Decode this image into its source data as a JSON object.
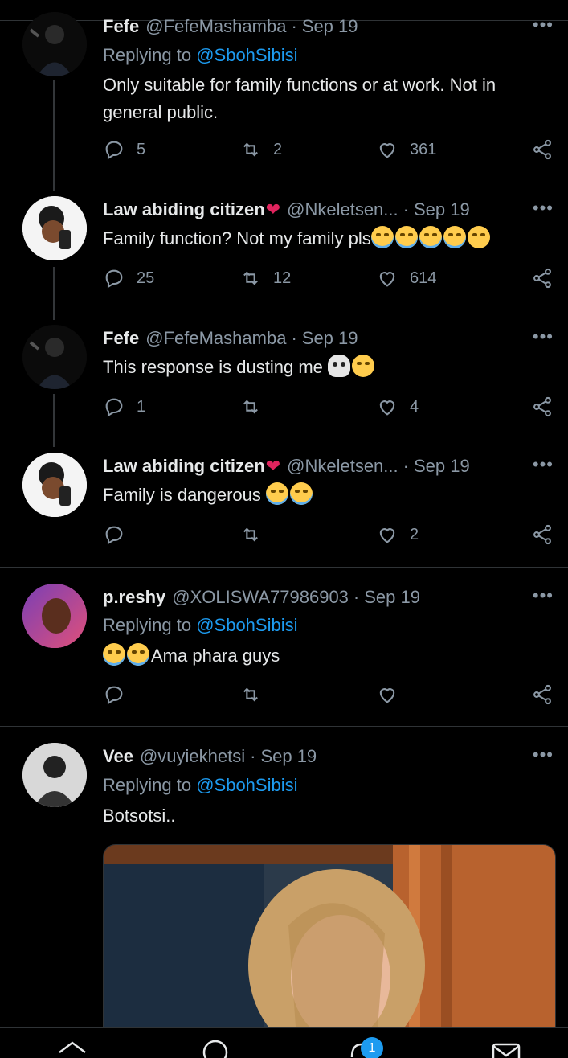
{
  "tweets": [
    {
      "name": "Fefe",
      "handle": "@FefeMashamba",
      "date": "Sep 19",
      "replying_label": "Replying to",
      "replying_to": "@SbohSibisi",
      "text": "Only suitable for family functions or at work. Not in general public.",
      "replies": "5",
      "retweets": "2",
      "likes": "361"
    },
    {
      "name": "Law abiding citizen",
      "handle": "@Nkeletsen...",
      "date": "Sep 19",
      "text": "Family function? Not my family pls",
      "replies": "25",
      "retweets": "12",
      "likes": "614"
    },
    {
      "name": "Fefe",
      "handle": "@FefeMashamba",
      "date": "Sep 19",
      "text": "This response is dusting me",
      "replies": "1",
      "retweets": "",
      "likes": "4"
    },
    {
      "name": "Law abiding citizen",
      "handle": "@Nkeletsen...",
      "date": "Sep 19",
      "text": "Family is dangerous",
      "replies": "",
      "retweets": "",
      "likes": "2"
    },
    {
      "name": "p.reshy",
      "handle": "@XOLISWA77986903",
      "date": "Sep 19",
      "replying_label": "Replying to",
      "replying_to": "@SbohSibisi",
      "text": "Ama phara guys",
      "replies": "",
      "retweets": "",
      "likes": ""
    },
    {
      "name": "Vee",
      "handle": "@vuyiekhetsi",
      "date": "Sep 19",
      "replying_label": "Replying to",
      "replying_to": "@SbohSibisi",
      "text": "Botsotsi.."
    }
  ],
  "nav": {
    "notifications_badge": "1"
  },
  "colors": {
    "background": "#000000",
    "accent": "#1d9bf0",
    "secondary_text": "#8b98a5",
    "divider": "#2f3336"
  }
}
